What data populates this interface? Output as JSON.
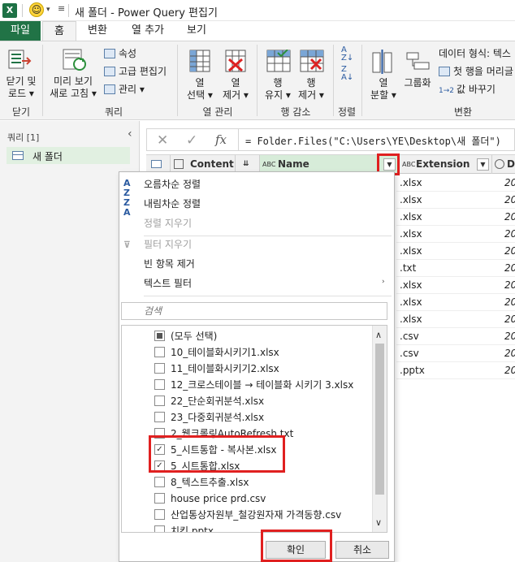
{
  "window": {
    "title": "새 폴더 - Power Query 편집기",
    "app_badge": "X"
  },
  "tabs": [
    "파일",
    "홈",
    "변환",
    "열 추가",
    "보기"
  ],
  "ribbon": {
    "close_btn": "닫기 및\n로드 ▾",
    "group_close": "닫기",
    "refresh_btn": "미리 보기\n새로 고침 ▾",
    "properties": "속성",
    "advanced_editor": "고급 편집기",
    "manage": "관리 ▾",
    "group_query": "쿼리",
    "choose_cols": "열\n선택 ▾",
    "remove_cols": "열\n제거 ▾",
    "group_manage_cols": "열 관리",
    "keep_rows": "행\n유지 ▾",
    "remove_rows": "행\n제거 ▾",
    "group_reduce_rows": "행 감소",
    "group_sort": "정렬",
    "split_col": "열\n분할 ▾",
    "group_by": "그룹화",
    "data_type": "데이터 형식: 텍스",
    "first_row_header": "첫 행을 머리글",
    "replace_values": "값 바꾸기",
    "group_transform": "변환"
  },
  "queries": {
    "header": "쿼리 [1]",
    "items": [
      "새 폴더"
    ]
  },
  "formula": {
    "text": "= Folder.Files(\"C:\\Users\\YE\\Desktop\\새 폴더\")",
    "cancel": "✕",
    "confirm": "✓",
    "fx": "fx"
  },
  "grid": {
    "columns": [
      "Content",
      "Name",
      "Extension",
      "D"
    ],
    "col_type_binary": "⇊",
    "col_type_text": "ABC",
    "extensions": [
      ".xlsx",
      ".xlsx",
      ".xlsx",
      ".xlsx",
      ".xlsx",
      ".txt",
      ".xlsx",
      ".xlsx",
      ".xlsx",
      ".csv",
      ".csv",
      ".pptx"
    ],
    "dates": [
      "202",
      "202",
      "202",
      "202",
      "202",
      "202",
      "20",
      "20",
      "202",
      "202",
      "202",
      "202"
    ]
  },
  "menu": {
    "sort_asc": "오름차순 정렬",
    "sort_desc": "내림차순 정렬",
    "clear_sort": "정렬 지우기",
    "clear_filter": "필터 지우기",
    "remove_empty": "빈 항목 제거",
    "text_filter": "텍스트 필터",
    "search_placeholder": "검색",
    "items": [
      {
        "label": "(모두 선택)",
        "state": "partial"
      },
      {
        "label": "10_테이블화시키기1.xlsx",
        "state": "off"
      },
      {
        "label": "11_테이블화시키기2.xlsx",
        "state": "off"
      },
      {
        "label": "12_크로스테이블 → 테이블화 시키기 3.xlsx",
        "state": "off"
      },
      {
        "label": "22_단순회귀분석.xlsx",
        "state": "off"
      },
      {
        "label": "23_다중회귀분석.xlsx",
        "state": "off"
      },
      {
        "label": "2_웹크롤링AutoRefresh.txt",
        "state": "off"
      },
      {
        "label": "5_시트통합 - 복사본.xlsx",
        "state": "on"
      },
      {
        "label": "5_시트통합.xlsx",
        "state": "on"
      },
      {
        "label": "8_텍스트추출.xlsx",
        "state": "off"
      },
      {
        "label": "house price prd.csv",
        "state": "off"
      },
      {
        "label": "산업통상자원부_철강원자재 가격동향.csv",
        "state": "off"
      },
      {
        "label": "치킨.pptx",
        "state": "off"
      }
    ],
    "ok": "확인",
    "cancel": "취소"
  },
  "colors": {
    "excel_green": "#217346",
    "highlight_red": "#e02020",
    "query_selected": "#e1f0e1"
  }
}
